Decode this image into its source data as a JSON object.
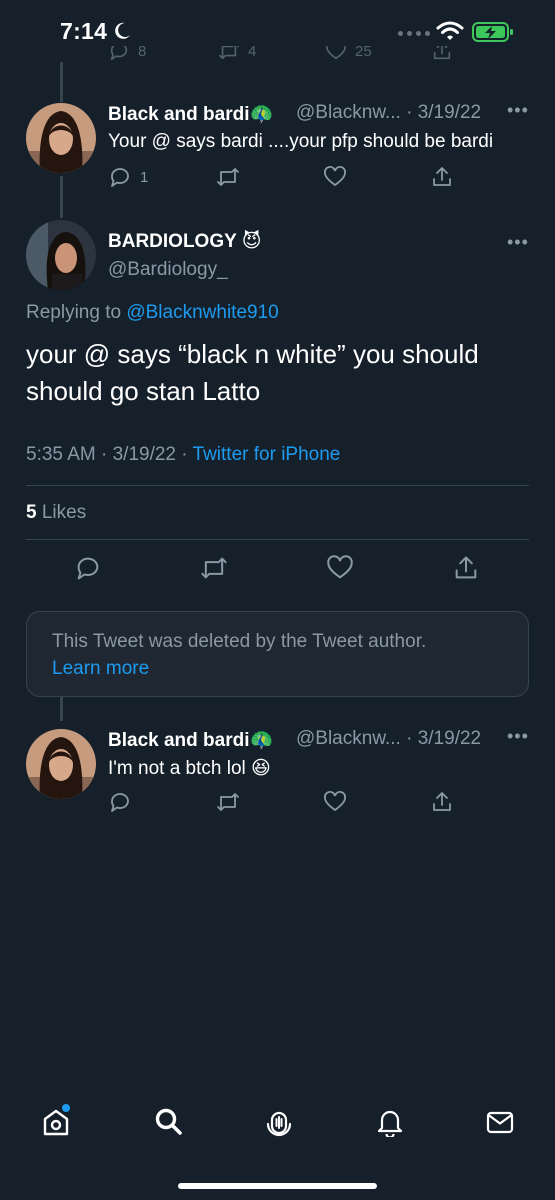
{
  "status_bar": {
    "time": "7:14"
  },
  "previous_tweet_actions": {
    "reply_count": "8",
    "retweet_count": "4",
    "like_count": "25"
  },
  "reply_1": {
    "name": "Black and bardi🦚",
    "handle_date": "@Blacknw... · 3/19/22",
    "text": "Your @ says bardi ....your pfp should be bardi",
    "reply_count": "1"
  },
  "main_tweet": {
    "name": "BARDIOLOGY 😈",
    "handle": "@Bardiology_",
    "replying_prefix": "Replying to ",
    "replying_to": "@Blacknwhite910",
    "text": "your @ says “black n white” you should should go stan Latto",
    "time_date": "5:35 AM · 3/19/22 · ",
    "source": "Twitter for iPhone",
    "likes_count": "5",
    "likes_label": " Likes"
  },
  "deleted_notice": {
    "text": "This Tweet was deleted by the Tweet author.",
    "link": "Learn more"
  },
  "reply_2": {
    "name": "Black and bardi🦚",
    "handle_date": "@Blacknw... · 3/19/22",
    "text": "I'm not a btch lol 😆"
  },
  "colors": {
    "background": "#15202b",
    "accent": "#1d9bf0",
    "muted": "#8b98a5",
    "border": "#38444d"
  }
}
